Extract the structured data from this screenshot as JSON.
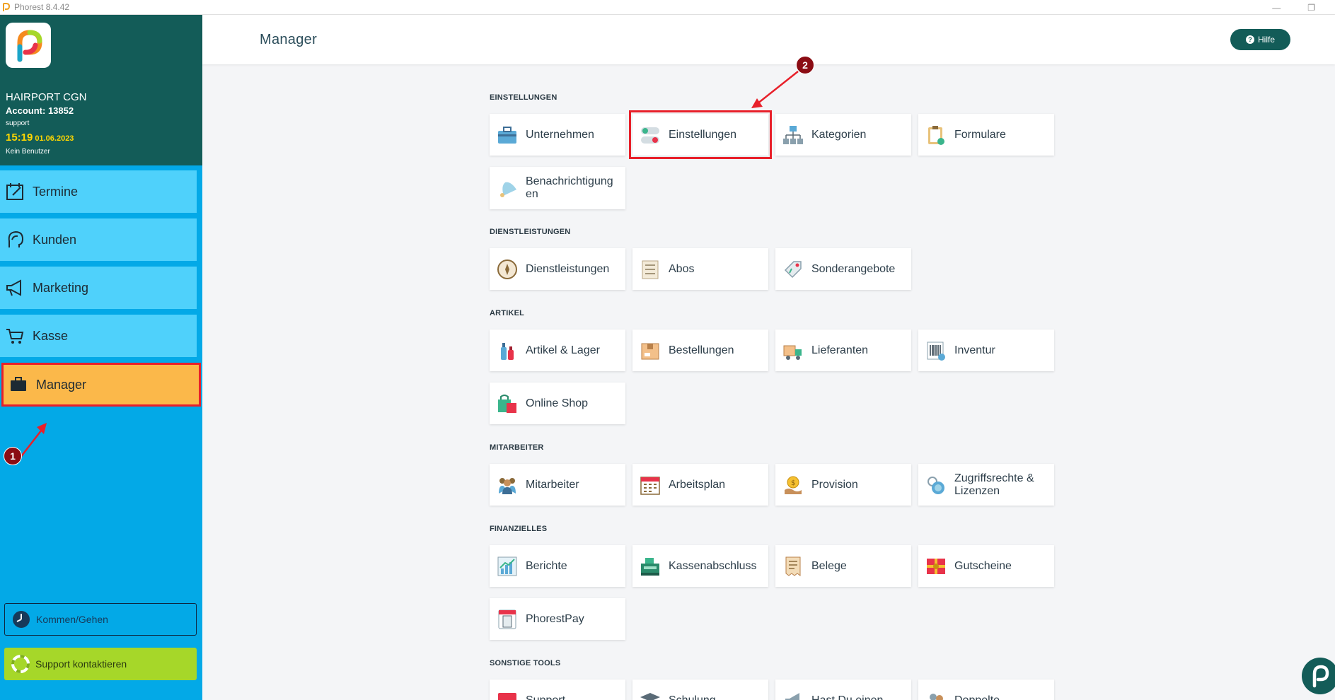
{
  "window": {
    "title": "Phorest 8.4.42",
    "minimize": "—",
    "restore": "❐"
  },
  "brand": {
    "shop": "HAIRPORT CGN",
    "account": "Account: 13852",
    "user": "support",
    "time": "15:19",
    "date": "01.06.2023",
    "no_user": "Kein Benutzer"
  },
  "nav": [
    {
      "label": "Termine",
      "icon": "calendar-icon"
    },
    {
      "label": "Kunden",
      "icon": "person-head-icon"
    },
    {
      "label": "Marketing",
      "icon": "megaphone-icon"
    },
    {
      "label": "Kasse",
      "icon": "cart-icon"
    },
    {
      "label": "Manager",
      "icon": "briefcase-icon",
      "active": true
    }
  ],
  "annotations": {
    "one": "1",
    "two": "2"
  },
  "clock_btn": "Kommen/Gehen",
  "support_btn": "Support kontaktieren",
  "header": {
    "title": "Manager",
    "help": "Hilfe"
  },
  "sections": [
    {
      "title": "EINSTELLUNGEN",
      "tiles": [
        "Unternehmen",
        "Einstellungen",
        "Kategorien",
        "Formulare",
        "Benachrichtigungen"
      ]
    },
    {
      "title": "DIENSTLEISTUNGEN",
      "tiles": [
        "Dienstleistungen",
        "Abos",
        "Sonderangebote"
      ]
    },
    {
      "title": "ARTIKEL",
      "tiles": [
        "Artikel & Lager",
        "Bestellungen",
        "Lieferanten",
        "Inventur",
        "Online Shop"
      ]
    },
    {
      "title": "MITARBEITER",
      "tiles": [
        "Mitarbeiter",
        "Arbeitsplan",
        "Provision",
        "Zugriffsrechte & Lizenzen"
      ]
    },
    {
      "title": "FINANZIELLES",
      "tiles": [
        "Berichte",
        "Kassenabschluss",
        "Belege",
        "Gutscheine",
        "PhorestPay"
      ]
    },
    {
      "title": "SONSTIGE TOOLS",
      "tiles": [
        "Support",
        "Schulung",
        "Hast Du einen",
        "Doppelte"
      ]
    }
  ],
  "colors": {
    "accent": "#135c58",
    "sidebar": "#03a9e7",
    "nav": "#4fd1fb",
    "active": "#fbb84a",
    "highlight": "#e8202a"
  }
}
